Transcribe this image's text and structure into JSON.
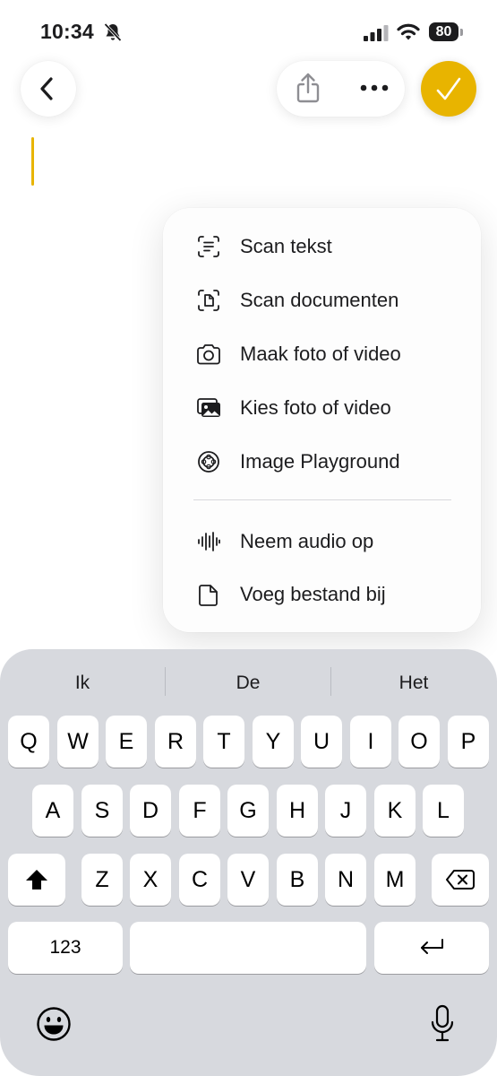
{
  "status": {
    "time": "10:34",
    "battery": "80"
  },
  "toolbar": {
    "back_icon": "chevron-left-icon",
    "share_icon": "share-icon",
    "more_icon": "more-icon",
    "done_icon": "checkmark-icon",
    "accent": "#e8b400"
  },
  "menu": {
    "items": [
      {
        "label": "Scan tekst",
        "icon": "scan-text-icon"
      },
      {
        "label": "Scan documenten",
        "icon": "scan-document-icon"
      },
      {
        "label": "Maak foto of video",
        "icon": "camera-icon"
      },
      {
        "label": "Kies foto of video",
        "icon": "photo-library-icon"
      },
      {
        "label": "Image Playground",
        "icon": "image-playground-icon"
      },
      {
        "label": "Neem audio op",
        "icon": "waveform-icon"
      },
      {
        "label": "Voeg bestand bij",
        "icon": "document-icon"
      }
    ]
  },
  "keyboard": {
    "suggestions": [
      "Ik",
      "De",
      "Het"
    ],
    "row1": [
      "Q",
      "W",
      "E",
      "R",
      "T",
      "Y",
      "U",
      "I",
      "O",
      "P"
    ],
    "row2": [
      "A",
      "S",
      "D",
      "F",
      "G",
      "H",
      "J",
      "K",
      "L"
    ],
    "row3": [
      "Z",
      "X",
      "C",
      "V",
      "B",
      "N",
      "M"
    ],
    "numbers_label": "123"
  }
}
